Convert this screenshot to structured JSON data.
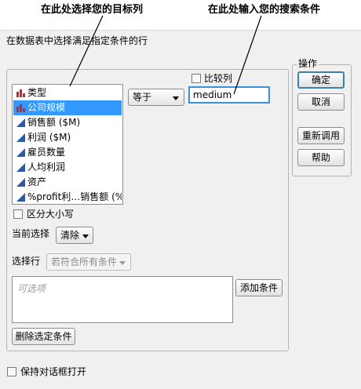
{
  "callouts": {
    "select_column": "在此处选择您的目标列",
    "enter_search": "在此处输入您的搜索条件"
  },
  "dialog": {
    "title": "在数据表中选择满足指定条件的行",
    "columns": [
      {
        "label": "类型",
        "icon": "nominal-bars-icon",
        "selected": false
      },
      {
        "label": "公司规模",
        "icon": "nominal-bars-icon",
        "selected": true
      },
      {
        "label": "销售额 ($M)",
        "icon": "continuous-triangle-icon",
        "selected": false
      },
      {
        "label": "利润 ($M)",
        "icon": "continuous-triangle-icon",
        "selected": false
      },
      {
        "label": "雇员数量",
        "icon": "continuous-triangle-icon",
        "selected": false
      },
      {
        "label": "人均利润",
        "icon": "continuous-triangle-icon",
        "selected": false
      },
      {
        "label": "资产",
        "icon": "continuous-triangle-icon",
        "selected": false
      },
      {
        "label": "%profit利…销售额 (%)",
        "icon": "continuous-triangle-icon",
        "selected": false
      }
    ],
    "operator": "等于",
    "compare_column_label": "比较列",
    "search_value": "medium",
    "case_sensitive_label": "区分大小写",
    "current_selection_label": "当前选择",
    "current_selection_value": "清除",
    "select_rows_label": "选择行",
    "select_rows_value": "若符合所有条件",
    "conditions_placeholder": "可选项",
    "add_condition": "添加条件",
    "delete_condition": "删除选定条件",
    "keep_open_label": "保持对话框打开",
    "actions": {
      "title": "操作",
      "ok": "确定",
      "cancel": "取消",
      "recall": "重新调用",
      "help": "帮助"
    }
  },
  "colors": {
    "selection": "#3399ff",
    "nominal_icon": "#c0282d",
    "continuous_icon": "#2a5aa8",
    "focus_border": "#3c8fd8"
  }
}
